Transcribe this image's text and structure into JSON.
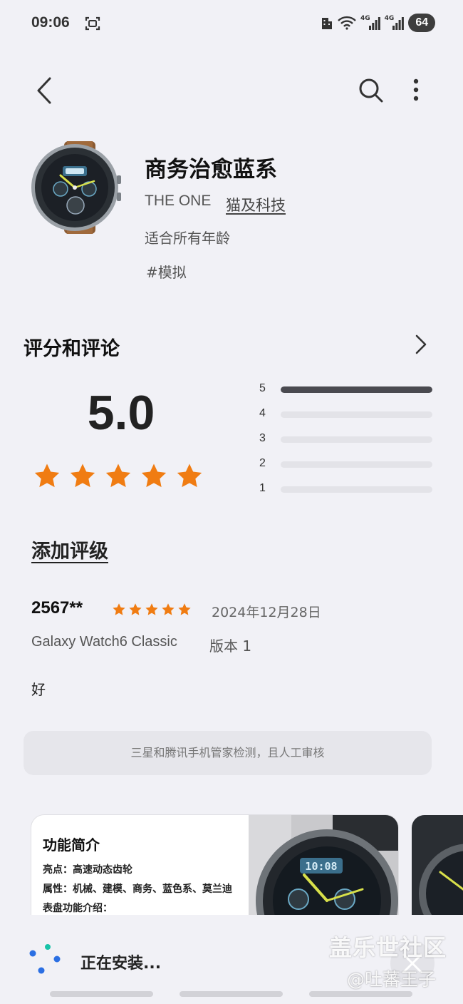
{
  "status_bar": {
    "time": "09:06",
    "network_1": "4G",
    "network_2": "4G",
    "battery": "64"
  },
  "header": {
    "back_icon": "chevron-left-icon",
    "search_icon": "search-icon",
    "more_icon": "more-vertical-icon"
  },
  "app": {
    "title": "商务治愈蓝系",
    "developer": "THE ONE",
    "publisher": "猫及科技",
    "age_rating": "适合所有年龄",
    "tag": "#模拟"
  },
  "ratings": {
    "heading": "评分和评论",
    "score": "5.0",
    "stars": 5,
    "histogram": [
      {
        "label": "5",
        "fraction": 1.0
      },
      {
        "label": "4",
        "fraction": 0.0
      },
      {
        "label": "3",
        "fraction": 0.0
      },
      {
        "label": "2",
        "fraction": 0.0
      },
      {
        "label": "1",
        "fraction": 0.0
      }
    ],
    "add_rating": "添加评级"
  },
  "review": {
    "user": "2567**",
    "stars": 5,
    "date": "2024年12月28日",
    "device": "Galaxy Watch6 Classic",
    "version": "版本 1",
    "text": "好"
  },
  "security_notice": "三星和腾讯手机管家检测，且人工审核",
  "screenshot_card": {
    "title": "功能简介",
    "lines": [
      "亮点：高速动态齿轮",
      "属性：机械、建模、商务、蓝色系、莫兰迪",
      "表盘功能介绍："
    ],
    "watch_display": "10:08"
  },
  "install": {
    "status": "正在安装...",
    "cancel_icon": "close-icon"
  },
  "watermark": {
    "line1": "盖乐世社区",
    "line2": "@吐蕃王子"
  },
  "colors": {
    "background": "#f1f1f6",
    "star": "#f07c12",
    "histogram_fill": "#4a4a50",
    "spinner_teal": "#18c3a8",
    "spinner_blue": "#2b6fe3"
  }
}
